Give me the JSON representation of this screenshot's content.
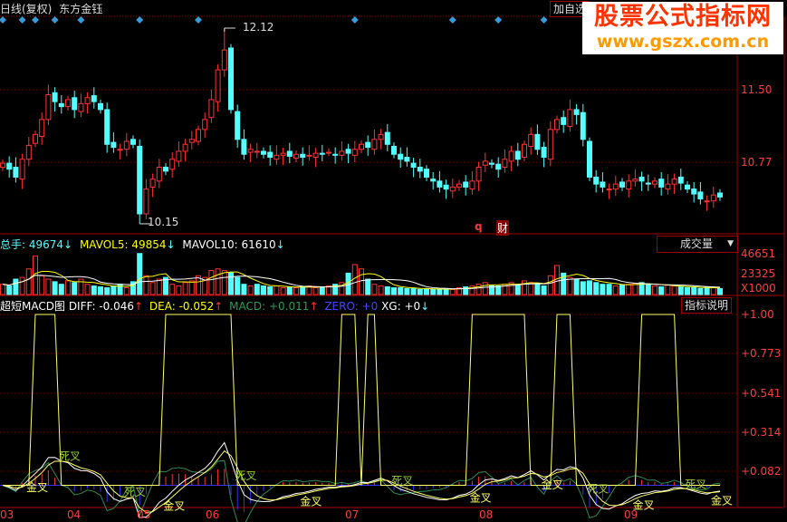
{
  "header": {
    "period": "日线(复权)",
    "stock_name": "东方金钰",
    "add_watch": "加自选"
  },
  "watermark": {
    "line1": "股票公式指标网",
    "line2": "www.gszx.com.cn"
  },
  "colors": {
    "up": "#ff3232",
    "down": "#54ffff",
    "grid": "#7a0000",
    "axis": "#ff3c3c",
    "ma5": "#ffff00",
    "ma10": "#ffffff",
    "diff": "#ffffff",
    "dea": "#ffff66",
    "macd": "#2e8b57",
    "zero": "#3333ff",
    "xg": "#ffff66"
  },
  "price_panel": {
    "axis_ticks": [
      "11.50",
      "10.77"
    ],
    "high_label": "12.12",
    "low_label": "10.15",
    "markers": [
      "q",
      "财"
    ],
    "info_marker_indices": [
      0,
      3,
      5,
      8,
      12,
      21,
      30,
      54,
      69,
      76,
      83,
      99
    ]
  },
  "volume_panel": {
    "total_label": "总手: 49674",
    "ma5_label": "MAVOL5: 49854",
    "ma10_label": "MAVOL10: 61610",
    "selector": "成交量",
    "axis_ticks": [
      "46651",
      "23325",
      "X1000"
    ]
  },
  "macd_panel": {
    "title": "超短MACD图",
    "diff_label": "DIFF: -0.046",
    "dea_label": "DEA: -0.052",
    "macd_label": "MACD: +0.011",
    "zero_label": "ZERO: +0",
    "xg_label": "XG: +0",
    "help_button": "指标说明",
    "axis_ticks": [
      "+1.00",
      "+0.773",
      "+0.541",
      "+0.314",
      "+0.082"
    ]
  },
  "date_axis": [
    "03",
    "04",
    "05",
    "06",
    "07",
    "08",
    "09"
  ],
  "chart_data": {
    "type": "candlestick",
    "price_ylim": [
      10.0,
      12.25
    ],
    "high": 12.12,
    "low": 10.15,
    "close": [
      10.76,
      10.7,
      10.62,
      10.8,
      10.94,
      11.05,
      11.2,
      11.45,
      11.38,
      11.33,
      11.4,
      11.3,
      11.36,
      11.42,
      11.38,
      11.3,
      10.95,
      10.92,
      10.9,
      10.98,
      10.95,
      10.25,
      10.5,
      10.6,
      10.72,
      10.68,
      10.8,
      10.88,
      10.95,
      11.0,
      11.1,
      11.2,
      11.4,
      11.7,
      11.9,
      11.3,
      11.0,
      10.85,
      10.9,
      10.88,
      10.85,
      10.82,
      10.84,
      10.86,
      10.83,
      10.85,
      10.82,
      10.84,
      10.86,
      10.85,
      10.87,
      10.84,
      10.88,
      10.86,
      10.9,
      10.95,
      10.92,
      11.0,
      11.05,
      10.95,
      10.85,
      10.8,
      10.78,
      10.72,
      10.68,
      10.62,
      10.58,
      10.52,
      10.5,
      10.52,
      10.55,
      10.52,
      10.58,
      10.72,
      10.78,
      10.75,
      10.7,
      10.8,
      10.88,
      10.8,
      10.95,
      11.05,
      10.9,
      10.82,
      11.1,
      11.2,
      11.15,
      11.3,
      11.25,
      11.0,
      10.62,
      10.55,
      10.52,
      10.5,
      10.55,
      10.52,
      10.58,
      10.6,
      10.58,
      10.55,
      10.58,
      10.52,
      10.55,
      10.6,
      10.56,
      10.5,
      10.45,
      10.4,
      10.38,
      10.44,
      10.42
    ],
    "volume_thousands": [
      12,
      10,
      18,
      20,
      30,
      45,
      22,
      18,
      15,
      12,
      16,
      14,
      18,
      12,
      10,
      9,
      8,
      10,
      12,
      8,
      15,
      48,
      22,
      14,
      18,
      20,
      12,
      10,
      14,
      16,
      22,
      20,
      28,
      30,
      28,
      26,
      20,
      12,
      10,
      12,
      10,
      9,
      10,
      8,
      9,
      8,
      9,
      10,
      8,
      9,
      10,
      12,
      14,
      25,
      35,
      30,
      18,
      12,
      10,
      9,
      8,
      8,
      7,
      7,
      6,
      7,
      6,
      6,
      7,
      6,
      8,
      9,
      10,
      12,
      14,
      11,
      10,
      12,
      14,
      12,
      16,
      14,
      12,
      10,
      22,
      34,
      25,
      20,
      18,
      15,
      16,
      14,
      12,
      12,
      10,
      11,
      12,
      13,
      14,
      12,
      10,
      9,
      11,
      10,
      9,
      8,
      8,
      7,
      9,
      8,
      7
    ],
    "volume_ylim": [
      0,
      66000
    ],
    "xg_signal_on_ranges": [
      [
        5,
        8
      ],
      [
        25,
        35
      ],
      [
        52,
        54
      ],
      [
        56,
        57
      ],
      [
        72,
        80
      ],
      [
        85,
        87
      ],
      [
        98,
        103
      ]
    ],
    "macd_ylim": [
      -0.15,
      1.05
    ],
    "cross_annotations": [
      {
        "index": 5,
        "label": "金叉"
      },
      {
        "index": 10,
        "label": "死叉"
      },
      {
        "index": 20,
        "label": "死叉"
      },
      {
        "index": 26,
        "label": "金叉"
      },
      {
        "index": 37,
        "label": "死叉"
      },
      {
        "index": 47,
        "label": "金叉"
      },
      {
        "index": 61,
        "label": "死叉"
      },
      {
        "index": 73,
        "label": "金叉"
      },
      {
        "index": 84,
        "label": "金叉"
      },
      {
        "index": 91,
        "label": "死叉"
      },
      {
        "index": 98,
        "label": "金叉"
      },
      {
        "index": 106,
        "label": "死叉"
      },
      {
        "index": 110,
        "label": "金叉"
      }
    ]
  }
}
